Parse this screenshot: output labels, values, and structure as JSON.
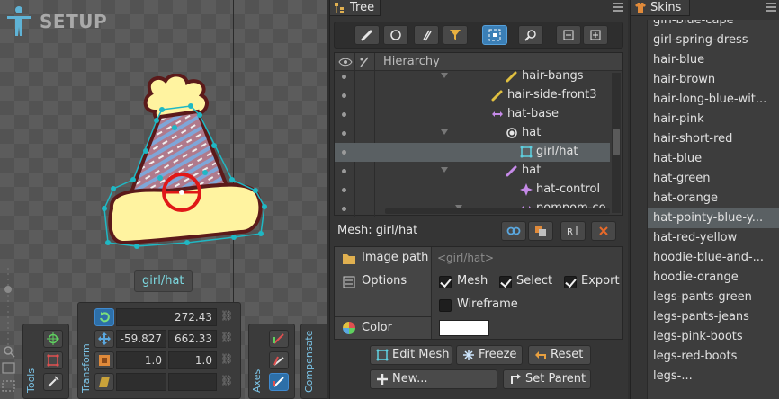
{
  "viewport": {
    "mode_label": "SETUP",
    "mesh_tag": "girl/hat",
    "tools_title": "Tools",
    "transform_title": "Transform",
    "axes_title": "Axes",
    "compensate_title": "Compensate",
    "transform": {
      "rotate": "272.43",
      "translate_x": "-59.827",
      "translate_y": "662.33",
      "scale_x": "1.0",
      "scale_y": "1.0"
    }
  },
  "tree": {
    "tab_label": "Tree",
    "hierarchy_header": "Hierarchy",
    "rows": [
      {
        "label": "hair-bangs",
        "icon": "bone-icon",
        "depth": 3
      },
      {
        "label": "hair-side-front3",
        "icon": "bone-icon",
        "depth": 2
      },
      {
        "label": "hat-base",
        "icon": "bone-arrow-icon",
        "depth": 2
      },
      {
        "label": "hat",
        "icon": "slot-icon",
        "depth": 3
      },
      {
        "label": "girl/hat",
        "icon": "mesh-icon",
        "depth": 4,
        "selected": true
      },
      {
        "label": "hat",
        "icon": "bone-icon",
        "depth": 3
      },
      {
        "label": "hat-control",
        "icon": "ik-icon",
        "depth": 4
      },
      {
        "label": "pompom-co",
        "icon": "bone-arrow-icon",
        "depth": 4
      }
    ],
    "mesh_title": "Mesh: girl/hat",
    "image_path_label": "Image path",
    "image_path_value": "<girl/hat>",
    "options_label": "Options",
    "opt_mesh": "Mesh",
    "opt_select": "Select",
    "opt_export": "Export",
    "opt_wireframe": "Wireframe",
    "color_label": "Color",
    "btn_edit_mesh": "Edit Mesh",
    "btn_freeze": "Freeze",
    "btn_reset": "Reset",
    "btn_new": "New...",
    "btn_set_parent": "Set Parent"
  },
  "skins": {
    "tab_label": "Skins",
    "items": [
      "girl-blue-cape",
      "girl-spring-dress",
      "hair-blue",
      "hair-brown",
      "hair-long-blue-wit...",
      "hair-pink",
      "hair-short-red",
      "hat-blue",
      "hat-green",
      "hat-orange",
      "hat-pointy-blue-y...",
      "hat-red-yellow",
      "hoodie-blue-and-...",
      "hoodie-orange",
      "legs-pants-green",
      "legs-pants-jeans",
      "legs-pink-boots",
      "legs-red-boots",
      "legs-..."
    ],
    "selected_index": 10
  },
  "colors": {
    "accent": "#3b7fb6",
    "selection": "#5a6063",
    "mesh_cyan": "#1fb8c4"
  }
}
